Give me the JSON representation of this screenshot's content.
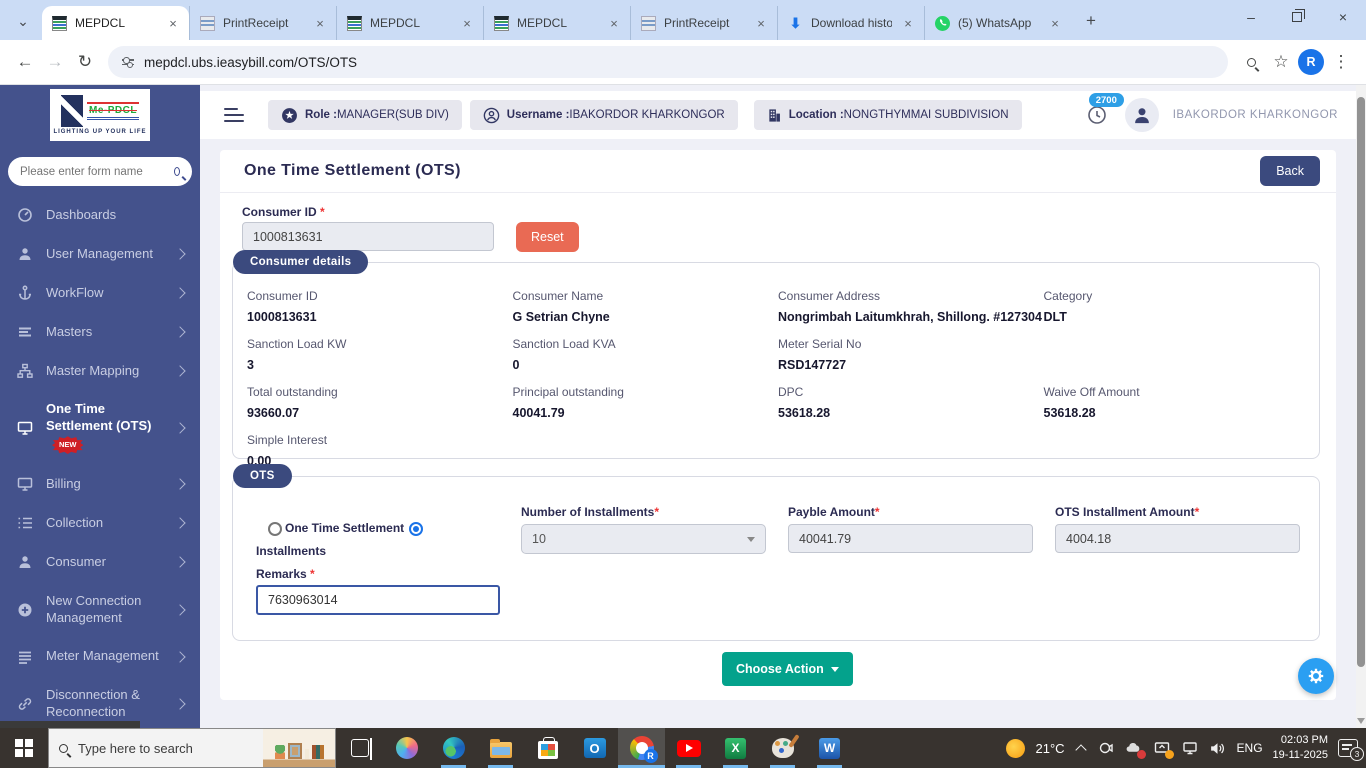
{
  "icons_legend": {
    "close": "×",
    "chevron_down": "⌄",
    "plus": "+",
    "minus": "–",
    "back_arrow": "←",
    "forward_arrow": "→",
    "reload": "↻",
    "star": "☆",
    "kebab": "⋮",
    "download": "⬇"
  },
  "browser": {
    "tabs": [
      {
        "label": "MEPDCL",
        "favicon": "mepdcl-favicon",
        "active": true
      },
      {
        "label": "PrintReceipt",
        "favicon": "receipt-favicon",
        "active": false
      },
      {
        "label": "MEPDCL",
        "favicon": "mepdcl-favicon",
        "active": false
      },
      {
        "label": "MEPDCL",
        "favicon": "mepdcl-favicon",
        "active": false
      },
      {
        "label": "PrintReceipt",
        "favicon": "receipt-favicon",
        "active": false
      },
      {
        "label": "Download histor",
        "favicon": "download-favicon",
        "active": false
      },
      {
        "label": "(5) WhatsApp",
        "favicon": "whatsapp-favicon",
        "active": false
      }
    ],
    "url": "mepdcl.ubs.ieasybill.com/OTS/OTS",
    "profile_initial": "R"
  },
  "sidebar": {
    "logo_text": "Me-PDCL",
    "logo_tagline": "LIGHTING UP YOUR LIFE",
    "search_placeholder": "Please enter form name",
    "items": [
      {
        "label": "Dashboards",
        "icon": "gauge-icon",
        "chevron": false
      },
      {
        "label": "User Management",
        "icon": "user-icon",
        "chevron": true
      },
      {
        "label": "WorkFlow",
        "icon": "anchor-icon",
        "chevron": true
      },
      {
        "label": "Masters",
        "icon": "bars-icon",
        "chevron": true
      },
      {
        "label": "Master Mapping",
        "icon": "sitemap-icon",
        "chevron": true
      },
      {
        "label": "One Time Settlement (OTS)",
        "icon": "monitor-icon",
        "chevron": true,
        "active": true,
        "badge": "NEW"
      },
      {
        "label": "Billing",
        "icon": "monitor-icon",
        "chevron": true
      },
      {
        "label": "Collection",
        "icon": "numbered-list-icon",
        "chevron": true
      },
      {
        "label": "Consumer",
        "icon": "user-icon",
        "chevron": true
      },
      {
        "label": "New Connection Management",
        "icon": "plus-circle-icon",
        "chevron": true
      },
      {
        "label": "Meter Management",
        "icon": "list-icon",
        "chevron": true
      },
      {
        "label": "Disconnection & Reconnection",
        "icon": "link-icon",
        "chevron": true
      }
    ]
  },
  "header": {
    "role_label": "Role :",
    "role_value": "MANAGER(SUB DIV)",
    "username_label": "Username :",
    "username_value": "IBAKORDOR KHARKONGOR",
    "location_label": "Location :",
    "location_value": "NONGTHYMMAI SUBDIVISION",
    "counter_badge": "2700",
    "user_display_name": "IBAKORDOR KHARKONGOR"
  },
  "page": {
    "title": "One Time Settlement (OTS)",
    "back_label": "Back",
    "required_marker": "*",
    "consumer_id_label": "Consumer ID",
    "consumer_id_value": "1000813631",
    "reset_label": "Reset"
  },
  "consumer_details": {
    "section_title": "Consumer details",
    "fields": [
      {
        "label": "Consumer ID",
        "value": "1000813631"
      },
      {
        "label": "Consumer Name",
        "value": "G Setrian Chyne"
      },
      {
        "label": "Consumer Address",
        "value": "Nongrimbah Laitumkhrah, Shillong. #127304"
      },
      {
        "label": "Category",
        "value": "DLT"
      },
      {
        "label": "Sanction Load KW",
        "value": "3"
      },
      {
        "label": "Sanction Load KVA",
        "value": "0"
      },
      {
        "label": "Meter Serial No",
        "value": "RSD147727"
      },
      {
        "label": "",
        "value": ""
      },
      {
        "label": "Total outstanding",
        "value": "93660.07"
      },
      {
        "label": "Principal outstanding",
        "value": "40041.79"
      },
      {
        "label": "DPC",
        "value": "53618.28"
      },
      {
        "label": "Waive Off Amount",
        "value": "53618.28"
      },
      {
        "label": "Simple Interest",
        "value": "0.00"
      },
      {
        "label": "",
        "value": ""
      },
      {
        "label": "",
        "value": ""
      },
      {
        "label": "",
        "value": ""
      }
    ]
  },
  "ots": {
    "section_title": "OTS",
    "radio_one_time_label": "One Time Settlement",
    "radio_installments_label": "Installments",
    "selected_option": "Installments",
    "installments_label": "Number of Installments",
    "installments_value": "10",
    "payble_label": "Payble Amount",
    "payble_value": "40041.79",
    "ots_installment_label": "OTS Installment Amount",
    "ots_installment_value": "4004.18",
    "remarks_label": "Remarks",
    "remarks_value": "7630963014",
    "choose_action_label": "Choose Action"
  },
  "taskbar": {
    "search_placeholder": "Type here to search",
    "temperature": "21°C",
    "language": "ENG",
    "time": "02:03 PM",
    "date": "19-11-2025",
    "notification_count": "3"
  },
  "colors": {
    "sidebar_bg": "#44528c",
    "primary_navy": "#3b4a7e",
    "reset_orange": "#e96a54",
    "action_teal": "#04a28c",
    "fab_blue": "#2b9ff2",
    "new_badge_red": "#cf1f25",
    "tabstrip_blue": "#cbdcf5",
    "counter_badge_blue": "#2e9fe6"
  }
}
